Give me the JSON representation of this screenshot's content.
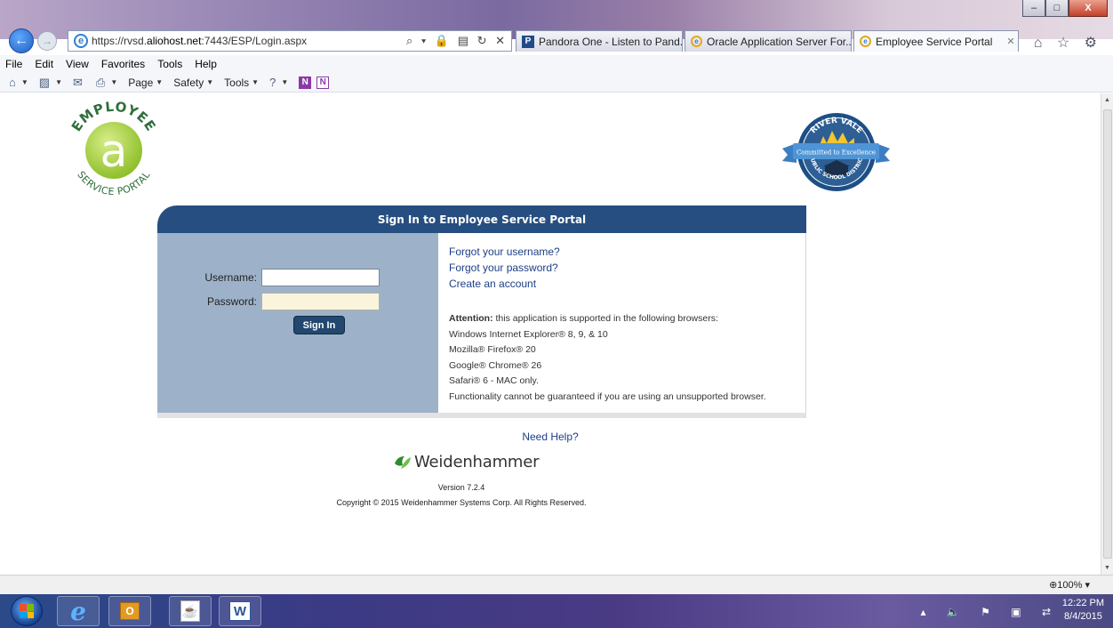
{
  "browser": {
    "address_url_plain": "https://rvsd.",
    "address_url_domain": "aliohost.net",
    "address_url_rest": ":7443/ESP/Login.aspx",
    "address_tools": "⌕ ▾ 🔒 ▤ ↻ ✕",
    "tabs": [
      {
        "label": "Pandora One - Listen to Pand...",
        "icon": "pandora-icon",
        "icon_glyph": "P"
      },
      {
        "label": "Oracle Application Server For...",
        "icon": "ie-icon",
        "icon_glyph": "e"
      },
      {
        "label": "Employee Service Portal",
        "icon": "ie-icon",
        "icon_glyph": "e",
        "active": true,
        "close": "✕"
      }
    ],
    "window_buttons": {
      "minimize": "–",
      "maximize": "□",
      "close": "X"
    },
    "toolbar_icons": "⌂ ☆ ⚙",
    "menu": [
      "File",
      "Edit",
      "View",
      "Favorites",
      "Tools",
      "Help"
    ],
    "commands": [
      {
        "label": "",
        "icon": "⌂"
      },
      {
        "label": "",
        "icon": "▨"
      },
      {
        "label": "",
        "icon": "✉"
      },
      {
        "label": "",
        "icon": "⎙"
      },
      {
        "label": "Page",
        "icon": ""
      },
      {
        "label": "Safety",
        "icon": ""
      },
      {
        "label": "Tools",
        "icon": ""
      },
      {
        "label": "",
        "icon": "?"
      }
    ],
    "onenote_glyph": "N",
    "zoom": "100%",
    "zoom_icon": "⊕"
  },
  "page": {
    "esp_logo": {
      "top_text": "EMPLOYEE",
      "bottom_text": "SERVICE PORTAL",
      "letter": "a"
    },
    "rv_logo": {
      "top_text": "RIVER VALE",
      "banner": "Committed to Excellence",
      "bottom_text": "PUBLIC SCHOOL DISTRICT"
    },
    "panel_title": "Sign In to Employee Service Portal",
    "username_label": "Username:",
    "password_label": "Password:",
    "username_value": "",
    "password_value": "",
    "signin_label": "Sign In",
    "links": [
      "Forgot your username?",
      "Forgot your password?",
      "Create an account"
    ],
    "attention_label": "Attention:",
    "attention_text": " this application is supported in the following browsers:",
    "browsers": [
      "Windows Internet Explorer® 8, 9, & 10",
      "Mozilla® Firefox® 20",
      "Google® Chrome® 26",
      "Safari® 6 - MAC only.",
      "Functionality cannot be guaranteed if you are using an unsupported browser."
    ],
    "need_help": "Need Help?",
    "brand": "Weidenhammer",
    "version": "Version 7.2.4",
    "copyright": "Copyright © 2015 Weidenhammer Systems Corp. All Rights Reserved."
  },
  "taskbar": {
    "ie_glyph": "e",
    "outlook_glyph": "O",
    "java_glyph": "☕",
    "word_glyph": "W",
    "tray_icons": "▴ 🔈 ⚑ ▣ ⇄",
    "time": "12:22 PM",
    "date": "8/4/2015"
  }
}
